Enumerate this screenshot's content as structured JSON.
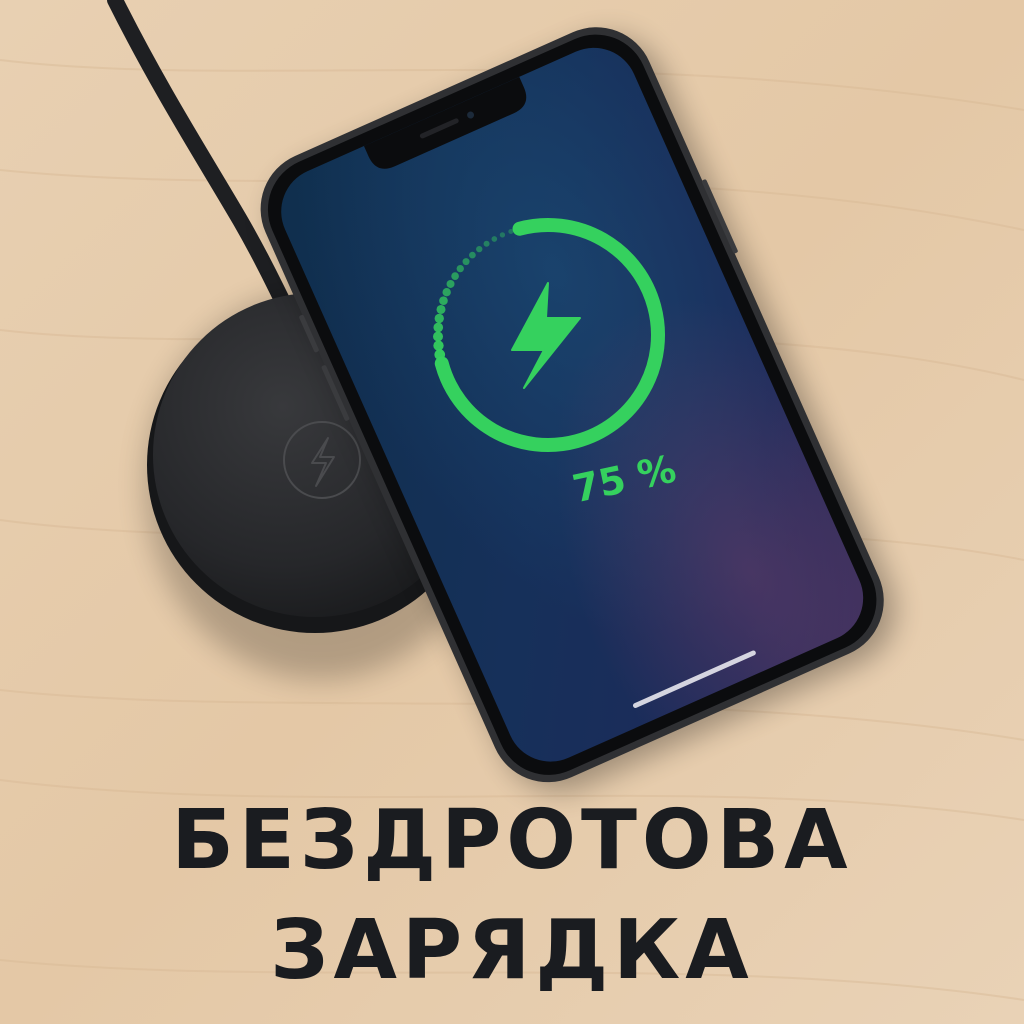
{
  "photo": {
    "background": "wooden-desk",
    "objects": [
      "wireless-charging-pad",
      "smartphone",
      "usb-cable"
    ]
  },
  "phone_screen": {
    "charge_percent_label": "75 %",
    "charge_level": 0.75,
    "center_icon": "lightning-bolt-icon",
    "accent_color": "#35d15e"
  },
  "charger": {
    "logo_icon": "lightning-bolt-icon"
  },
  "headline": {
    "line1": "БЕЗДРОТОВА",
    "line2": "ЗАРЯДКА"
  },
  "colors": {
    "wood": "#e6ccad",
    "pad": "#2a2b2d",
    "text": "#1a1c20"
  }
}
